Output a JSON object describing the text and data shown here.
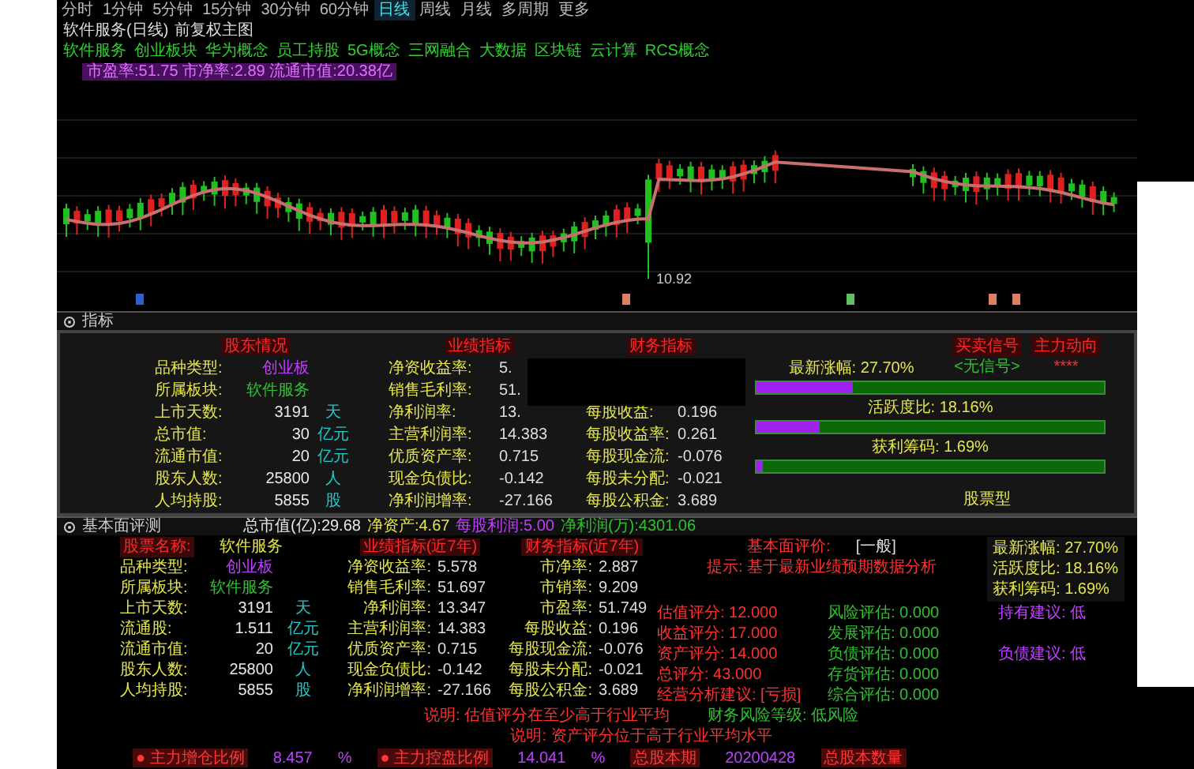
{
  "toolbar": [
    {
      "label": "分时",
      "selected": false
    },
    {
      "label": "1分钟",
      "selected": false
    },
    {
      "label": "5分钟",
      "selected": false
    },
    {
      "label": "15分钟",
      "selected": false
    },
    {
      "label": "30分钟",
      "selected": false
    },
    {
      "label": "60分钟",
      "selected": false
    },
    {
      "label": "日线",
      "selected": true
    },
    {
      "label": "周线",
      "selected": false
    },
    {
      "label": "月线",
      "selected": false
    },
    {
      "label": "多周期",
      "selected": false
    },
    {
      "label": "更多",
      "selected": false
    }
  ],
  "chart_header": {
    "title": "软件服务(日线)",
    "subtitle": "前复权主图"
  },
  "concept_tags": [
    "软件服务",
    "创业板块",
    "华为概念",
    "员工持股",
    "5G概念",
    "三网融合",
    "大数据",
    "区块链",
    "云计算",
    "RCS概念"
  ],
  "valuation_line": "市盈率:51.75 市净率:2.89 流通市值:20.38亿",
  "chart": {
    "low_price_label": "10.92"
  },
  "indicator_panel": {
    "title": "指标",
    "holders": {
      "header": "股东情况",
      "rows": [
        {
          "label": "品种类型:",
          "value": "创业板",
          "color": "#c040ff"
        },
        {
          "label": "所属板块:",
          "value": "软件服务",
          "color": "#30c030"
        },
        {
          "label": "上市天数:",
          "value": "3191",
          "unit": "天",
          "color": "#e8e8e8"
        },
        {
          "label": "总市值:",
          "value": "30",
          "unit": "亿元",
          "color": "#e8e8e8"
        },
        {
          "label": "流通市值:",
          "value": "20",
          "unit": "亿元",
          "color": "#e8e8e8"
        },
        {
          "label": "股东人数:",
          "value": "25800",
          "unit": "人",
          "color": "#e8e8e8"
        },
        {
          "label": "人均持股:",
          "value": "5855",
          "unit": "股",
          "color": "#e8e8e8"
        }
      ]
    },
    "performance": {
      "header": "业绩指标",
      "rows": [
        {
          "label": "净资收益率:",
          "value": "5."
        },
        {
          "label": "销售毛利率:",
          "value": "51."
        },
        {
          "label": "净利润率:",
          "value": "13."
        },
        {
          "label": "主营利润率:",
          "value": "14.383"
        },
        {
          "label": "优质资产率:",
          "value": "0.715"
        },
        {
          "label": "现金负债比:",
          "value": "-0.142"
        },
        {
          "label": "净利润增率:",
          "value": "-27.166"
        }
      ]
    },
    "finance": {
      "header": "财务指标",
      "rows": [
        {
          "label": "每股收益:",
          "value": "0.196"
        },
        {
          "label": "每股收益率:",
          "value": "0.261"
        },
        {
          "label": "每股现金流:",
          "value": "-0.076"
        },
        {
          "label": "每股未分配:",
          "value": "-0.021"
        },
        {
          "label": "每股公积金:",
          "value": "3.689"
        }
      ]
    },
    "meters": [
      {
        "label": "最新涨幅:",
        "reading": "27.70%",
        "level": 0.277
      },
      {
        "label": "活跃度比:",
        "reading": "18.16%",
        "level": 0.1816
      },
      {
        "label": "获利筹码:",
        "reading": "1.69%",
        "level": 0.0169
      }
    ],
    "signal": {
      "header": "买卖信号",
      "value": "<无信号>"
    },
    "main_force": {
      "header": "主力动向",
      "value": "****"
    },
    "stock_type": "股票型"
  },
  "fundamental_panel": {
    "title": "基本面评测",
    "summary": [
      {
        "text": "总市值(亿):29.68",
        "color": "#e8e8e8"
      },
      {
        "text": "净资产:4.67",
        "color": "#e6e64c"
      },
      {
        "text": "每股利润:5.00",
        "color": "#c040ff"
      },
      {
        "text": "净利润(万):4301.06",
        "color": "#30c030"
      }
    ],
    "name_label": "股票名称:",
    "name_value": "软件服务",
    "performance_header": "业绩指标(近7年)",
    "finance_header": "财务指标(近7年)",
    "holders": [
      {
        "label": "品种类型:",
        "value": "创业板",
        "color": "#c040ff"
      },
      {
        "label": "所属板块:",
        "value": "软件服务",
        "color": "#30c030"
      },
      {
        "label": "上市天数:",
        "value": "3191",
        "unit": "天",
        "color": "#e8e8e8"
      },
      {
        "label": "流通股:",
        "value": "1.511",
        "unit": "亿元",
        "color": "#e8e8e8"
      },
      {
        "label": "流通市值:",
        "value": "20",
        "unit": "亿元",
        "color": "#e8e8e8"
      },
      {
        "label": "股东人数:",
        "value": "25800",
        "unit": "人",
        "color": "#e8e8e8"
      },
      {
        "label": "人均持股:",
        "value": "5855",
        "unit": "股",
        "color": "#e8e8e8"
      }
    ],
    "performance": [
      {
        "label": "净资收益率:",
        "value": "5.578"
      },
      {
        "label": "销售毛利率:",
        "value": "51.697"
      },
      {
        "label": "净利润率:",
        "value": "13.347"
      },
      {
        "label": "主营利润率:",
        "value": "14.383"
      },
      {
        "label": "优质资产率:",
        "value": "0.715"
      },
      {
        "label": "现金负债比:",
        "value": "-0.142"
      },
      {
        "label": "净利润增率:",
        "value": "-27.166"
      }
    ],
    "finance": [
      {
        "label": "市净率:",
        "value": "2.887"
      },
      {
        "label": "市销率:",
        "value": "9.209"
      },
      {
        "label": "市盈率:",
        "value": "51.749"
      },
      {
        "label": "每股收益:",
        "value": "0.196"
      },
      {
        "label": "每股现金流:",
        "value": "-0.076"
      },
      {
        "label": "每股未分配:",
        "value": "-0.021"
      },
      {
        "label": "每股公积金:",
        "value": "3.689"
      }
    ],
    "rating_label": "基本面评价:",
    "rating": "[一般]",
    "note": "提示: 基于最新业绩预期数据分析",
    "stats": [
      "最新涨幅: 27.70%",
      "活跃度比: 18.16%",
      "获利筹码: 1.69%"
    ],
    "scores": [
      [
        {
          "text": "估值评分: 12.000",
          "color": "#ff3030"
        },
        {
          "text": "风险评估: 0.000",
          "color": "#30c030"
        },
        {
          "text": "持有建议: 低",
          "color": "#c040ff"
        }
      ],
      [
        {
          "text": "收益评分: 17.000",
          "color": "#ff3030"
        },
        {
          "text": "发展评估: 0.000",
          "color": "#30c030"
        }
      ],
      [
        {
          "text": "资产评分: 14.000",
          "color": "#ff3030"
        },
        {
          "text": "负债评估: 0.000",
          "color": "#30c030"
        },
        {
          "text": "负债建议: 低",
          "color": "#c040ff"
        }
      ],
      [
        {
          "text": "总评分: 43.000",
          "color": "#ff3030"
        },
        {
          "text": "存货评估: 0.000",
          "color": "#30c030"
        }
      ],
      [
        {
          "text": "经营分析建议: [亏损]",
          "color": "#ff3030"
        },
        {
          "text": "综合评估: 0.000",
          "color": "#30c030"
        }
      ]
    ],
    "notes": [
      [
        {
          "text": "说明: 估值评分在至少高于行业平均",
          "color": "#ff3030"
        },
        {
          "text": "财务风险等级: 低风险",
          "color": "#30c030"
        }
      ],
      [
        {
          "text": "说明: 资产评分位于高于行业平均水平",
          "color": "#ff3030"
        }
      ]
    ],
    "footer": [
      {
        "kind": "tag",
        "text": "● 主力增仓比例"
      },
      {
        "kind": "value",
        "text": "8.457"
      },
      {
        "kind": "value",
        "text": "%"
      },
      {
        "kind": "tag",
        "text": "● 主力控盘比例"
      },
      {
        "kind": "value",
        "text": "14.041"
      },
      {
        "kind": "value",
        "text": "%"
      },
      {
        "kind": "tag",
        "text": "总股本期"
      },
      {
        "kind": "value",
        "text": "20200428"
      },
      {
        "kind": "tag",
        "text": "总股本数量"
      }
    ]
  }
}
